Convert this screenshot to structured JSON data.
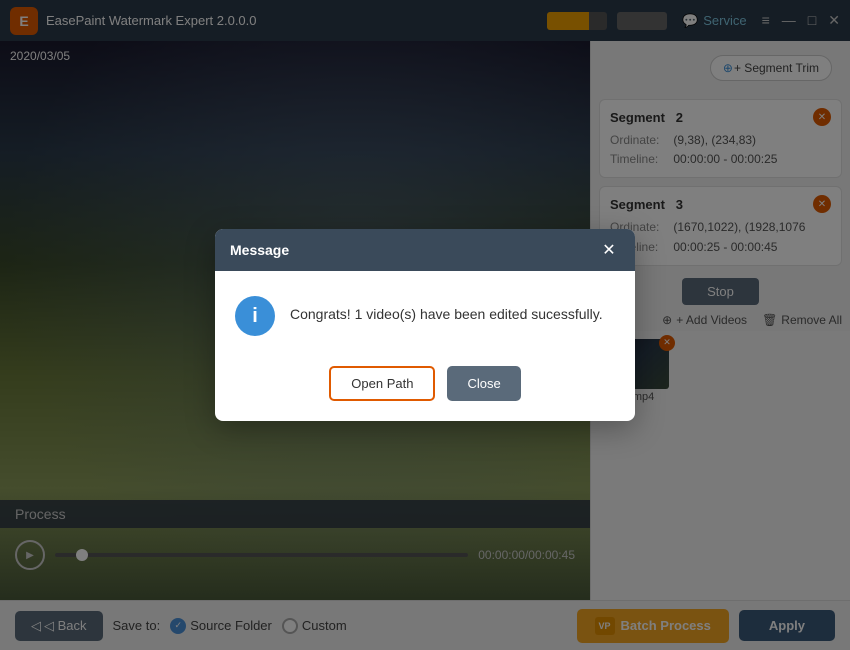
{
  "app": {
    "title": "EasePaint Watermark Expert  2.0.0.0",
    "logo_letter": "E"
  },
  "title_bar": {
    "service_label": "Service",
    "minimize_icon": "—",
    "maximize_icon": "□",
    "close_icon": "✕",
    "hamburger_icon": "≡"
  },
  "right_panel": {
    "segment_trim_label": "+ Segment Trim",
    "segment2": {
      "title": "Segment",
      "number": "2",
      "ordinate_label": "Ordinate:",
      "ordinate_value": "(9,38), (234,83)",
      "timeline_label": "Timeline:",
      "timeline_value": "00:00:00 - 00:00:25"
    },
    "segment3": {
      "title": "Segment",
      "number": "3",
      "ordinate_label": "Ordinate:",
      "ordinate_value": "(1670,1022), (1928,1076",
      "timeline_label": "Timeline:",
      "timeline_value": "00:00:25 - 00:00:45"
    },
    "add_videos_label": "+ Add Videos",
    "remove_all_label": "🗑 Remove All",
    "video_item": {
      "name": "3.mp4"
    }
  },
  "video_panel": {
    "date": "2020/03/05",
    "process_label": "Process",
    "time_display": "00:00:00/00:00:45"
  },
  "bottom_bar": {
    "back_label": "◁ Back",
    "save_to_label": "Save to:",
    "source_folder_label": "Source Folder",
    "custom_label": "Custom",
    "batch_process_label": "Batch Process",
    "apply_label": "Apply"
  },
  "modal": {
    "title": "Message",
    "close_icon": "✕",
    "icon_letter": "i",
    "message": "Congrats! 1 video(s) have been edited sucessfully.",
    "open_path_label": "Open Path",
    "close_label": "Close"
  },
  "colors": {
    "accent_orange": "#e05a00",
    "accent_blue": "#3a5a7a",
    "accent_yellow": "#f5a623",
    "segment_trim_plus": "#3a8fd8"
  }
}
